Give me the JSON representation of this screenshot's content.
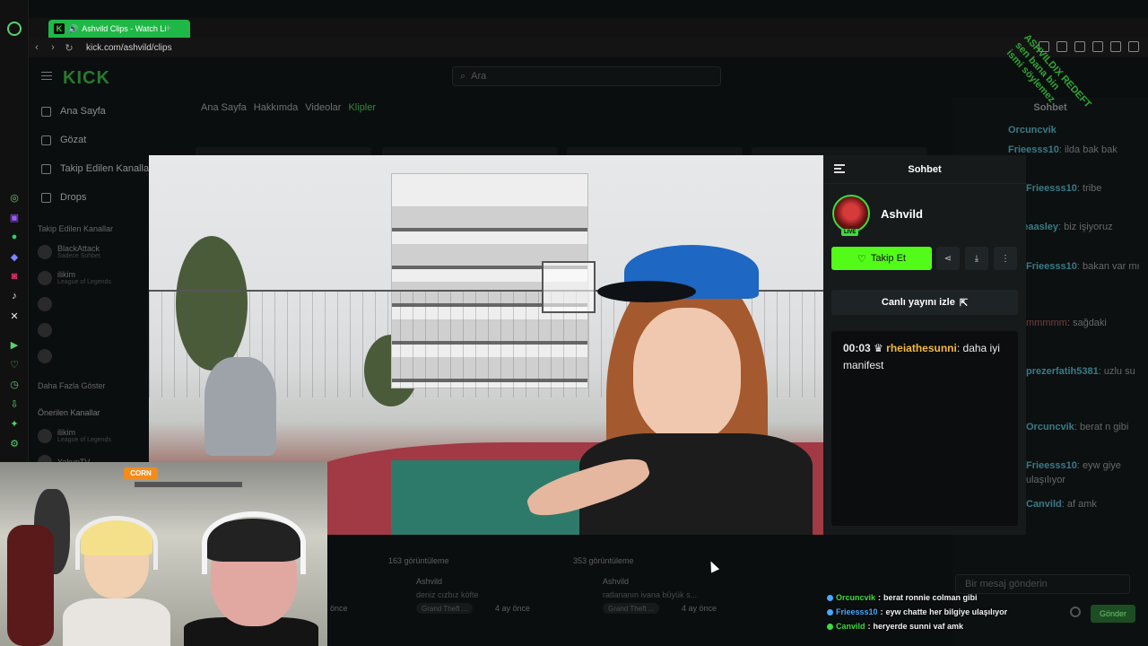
{
  "browser": {
    "tab_title": "Ashvild Clips - Watch Li",
    "url": "kick.com/ashvild/clips"
  },
  "kick": {
    "logo": "KICK",
    "search_placeholder": "Ara",
    "nav": [
      {
        "label": "Ana Sayfa",
        "icon": "home-icon"
      },
      {
        "label": "Gözat",
        "icon": "browse-icon"
      },
      {
        "label": "Takip Edilen Kanallar",
        "icon": "heart-icon"
      },
      {
        "label": "Drops",
        "icon": "drops-icon"
      }
    ],
    "followed_heading": "Takip Edilen Kanallar",
    "followed": [
      {
        "name": "BlackAttack",
        "sub": "Sadece Sohbet"
      },
      {
        "name": "ilikim",
        "sub": "League of Legends"
      }
    ],
    "show_more": "Daha Fazla Göster",
    "recommended_heading": "Önerilen Kanallar",
    "recommended": [
      {
        "name": "ilikim",
        "sub": "League of Legends"
      },
      {
        "name": "YakupTV",
        "sub": ""
      }
    ],
    "tabs": [
      "Ana Sayfa",
      "Hakkımda",
      "Videolar",
      "Klipler"
    ],
    "active_tab": "Klipler",
    "chat_title": "Sohbet",
    "chat_bg": [
      {
        "user": "Orcuncvik",
        "text": ""
      },
      {
        "user": "Frieesss10",
        "text": "ilda bak bak"
      },
      {
        "user": "Frieesss10",
        "text": "tribe"
      },
      {
        "user": "reaasley",
        "text": "biz işiyoruz"
      },
      {
        "user": "Frieesss10",
        "text": "bakan var mı"
      },
      {
        "user": "mmmmm",
        "text": "sağdaki"
      },
      {
        "user": "prezerfatih5381",
        "text": "uzlu su"
      },
      {
        "user": "Orcuncvik",
        "text": "berat n gibi"
      },
      {
        "user": "Frieesss10",
        "text": "eyw giye ulaşılıyor"
      },
      {
        "user": "Canvild",
        "text": "af amk"
      }
    ],
    "chat_placeholder": "Bir mesaj gönderin",
    "send_label": "Gönder",
    "clips": [
      {
        "views": "163 görüntüleme",
        "channel": "Ashvild",
        "title": "deniz cızbız köfte",
        "game": "Grand Theft ...",
        "age": "4 ay önce"
      },
      {
        "views": "353 görüntüleme",
        "channel": "Ashvild",
        "title": "ratlananın ivana büyük s...",
        "game": "Grand Theft ...",
        "age": "4 ay önce"
      }
    ],
    "clip_left_age": "önce"
  },
  "modal": {
    "chat_heading": "Sohbet",
    "streamer_name": "Ashvild",
    "live_badge": "LIVE",
    "follow_label": "Takip Et",
    "watch_live_label": "Canlı yayını izle",
    "chat_message": {
      "time": "00:03",
      "user": "rheiathesunni",
      "text": "daha iyi manifest"
    }
  },
  "overlay_chat": [
    {
      "user": "Orcuncvik",
      "text": "berat ronnie colman gibi",
      "color": "#3ddc3d"
    },
    {
      "user": "Frieesss10",
      "text": "eyw chatte her bilgiye ulaşılıyor",
      "color": "#4aa8ff"
    },
    {
      "user": "Canvild",
      "text": "heryerde sunni vaf amk",
      "color": "#3ddc3d"
    }
  ],
  "webcam": {
    "sign": "CORN"
  },
  "watermark": [
    "ASHVILDIX REDEFT",
    "sen bana bin",
    "ismi söylemez"
  ]
}
